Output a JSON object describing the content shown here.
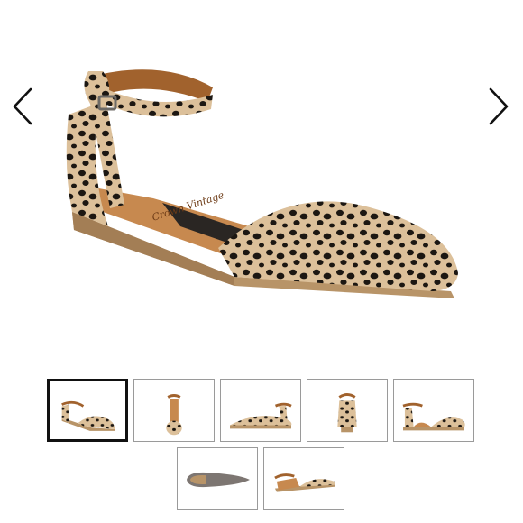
{
  "gallery": {
    "prev_icon": "chevron-left-icon",
    "next_icon": "chevron-right-icon",
    "brand_script": "Crown Vintage",
    "colors": {
      "pattern_base": "#dcc09a",
      "pattern_spot": "#1c1712",
      "heel_wood": "#b89468",
      "insole": "#c7894f",
      "selected_border": "#111111",
      "thumb_border": "#9a9a9a"
    },
    "thumbnails": [
      {
        "view": "side-angle",
        "selected": true
      },
      {
        "view": "front",
        "selected": false
      },
      {
        "view": "side",
        "selected": false
      },
      {
        "view": "back",
        "selected": false
      },
      {
        "view": "inner-side",
        "selected": false
      },
      {
        "view": "sole",
        "selected": false
      },
      {
        "view": "top-angle",
        "selected": false
      }
    ]
  }
}
